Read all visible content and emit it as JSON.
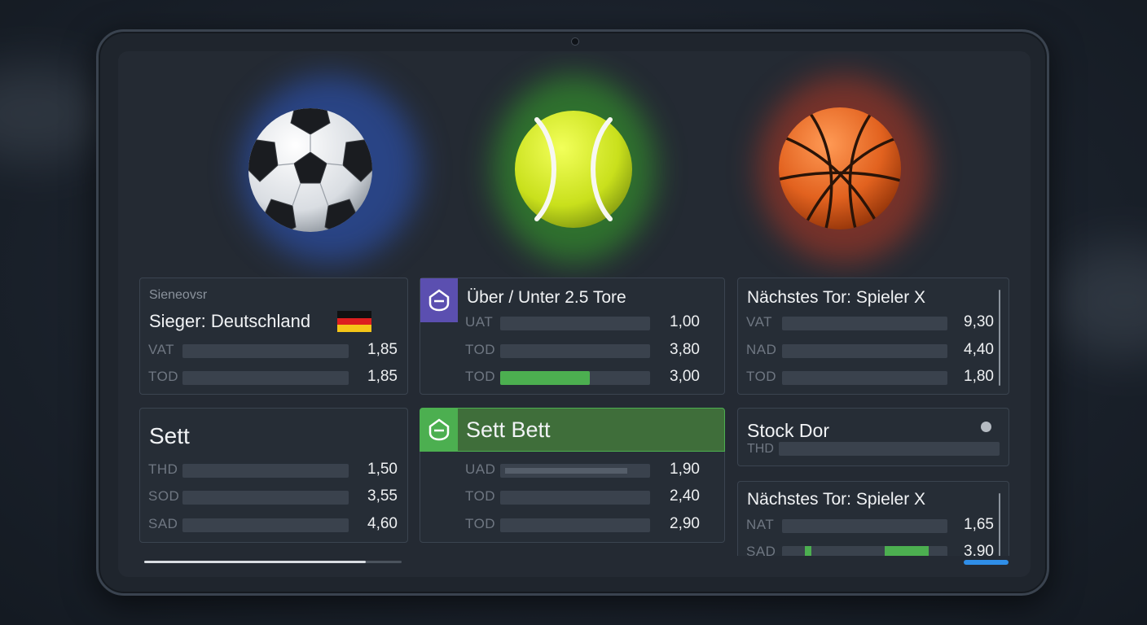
{
  "colors": {
    "accent_green": "#4caf50",
    "accent_purple": "#5b4fb0",
    "accent_blue": "#2f8ee8"
  },
  "icons": {
    "soccer": "soccer-ball-icon",
    "tennis": "tennis-ball-icon",
    "basketball": "basketball-icon",
    "flag": "germany-flag-icon",
    "tag": "tag-icon",
    "dot": "status-dot-icon"
  },
  "cards": {
    "c1": {
      "subtitle": "Sieneovsr",
      "title": "Sieger: Deutschland",
      "rows": [
        {
          "label": "VAT",
          "value": "1,85",
          "fill": 0
        },
        {
          "label": "TOD",
          "value": "1,85",
          "fill": 0
        }
      ]
    },
    "c2": {
      "title": "Über / Unter 2.5 Tore",
      "rows": [
        {
          "label": "UAT",
          "value": "1,00",
          "fill": 0
        },
        {
          "label": "TOD",
          "value": "3,80",
          "fill": 0
        },
        {
          "label": "TOD",
          "value": "3,00",
          "fill": 0.6
        }
      ]
    },
    "c3": {
      "title": "Nächstes Tor: Spieler X",
      "rows": [
        {
          "label": "VAT",
          "value": "9,30",
          "fill": 0
        },
        {
          "label": "NAD",
          "value": "4,40",
          "fill": 0
        },
        {
          "label": "TOD",
          "value": "1,80",
          "fill": 0
        }
      ]
    },
    "c4": {
      "title": "Sett",
      "rows": [
        {
          "label": "THD",
          "value": "1,50",
          "fill": 0
        },
        {
          "label": "SOD",
          "value": "3,55",
          "fill": 0
        },
        {
          "label": "SAD",
          "value": "4,60",
          "fill": 0
        }
      ]
    },
    "c5": {
      "title": "Sett Bett",
      "rows": [
        {
          "label": "UAD",
          "value": "1,90",
          "fill": 0
        },
        {
          "label": "TOD",
          "value": "2,40",
          "fill": 0
        },
        {
          "label": "TOD",
          "value": "2,90",
          "fill": 0
        }
      ]
    },
    "c6": {
      "title": "Stock Dor",
      "row_label": "THD"
    },
    "c7": {
      "title": "Nächstes Tor: Spieler X",
      "rows": [
        {
          "label": "NAT",
          "value": "1,65",
          "fill": 0
        },
        {
          "label": "SAD",
          "value": "3,90",
          "fill": 0.3
        }
      ]
    }
  }
}
